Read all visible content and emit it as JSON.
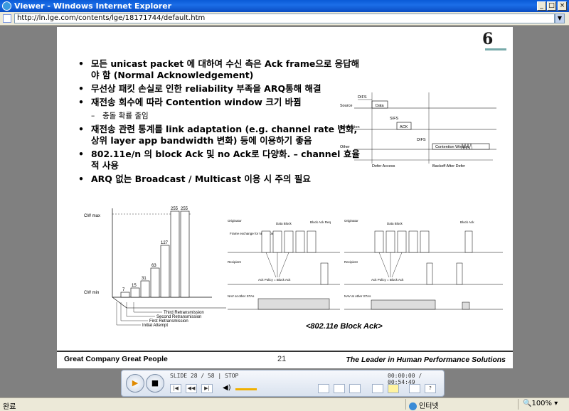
{
  "window": {
    "title": "Viewer - Windows Internet Explorer",
    "minimize": "_",
    "maximize": "□",
    "close": "×"
  },
  "address": {
    "url": "http://ln.lge.com/contents/lge/18171744/default.htm"
  },
  "slide": {
    "logo": "6",
    "bullets": [
      "모든 unicast packet 에 대하여 수신 측은 Ack frame으로 응답해야 함 (Normal Acknowledgement)",
      "무선상 패킷 손실로 인한 reliability 부족을 ARQ통해 해결",
      "재전송 회수에 따라 Contention window 크기 바뀜",
      "재전송 관련 통계를 link adaptation (e.g. channel rate 변화, 상위 layer app bandwidth 변화) 등에 이용하기 좋음",
      "802.11e/n 의 block Ack 및 no Ack로 다양화. – channel 효율적 사용",
      "ARQ 없는 Broadcast / Multicast 이용 시 주의 필요"
    ],
    "sub_bullet": "충돌 확률 줄임",
    "timing": {
      "difs1": "DIFS",
      "sifs": "SIFS",
      "difs2": "DIFS",
      "data": "Data",
      "ack": "ACK",
      "cw": "Contention Window",
      "source": "Source",
      "destination": "Destination",
      "other": "Other",
      "defer_access": "Defer Access",
      "backoff": "Backoff After Defer"
    },
    "cw_chart": {
      "cw_max": "CW max",
      "cw_min": "CW min",
      "values": [
        "7",
        "15",
        "31",
        "63",
        "127",
        "255",
        "255"
      ],
      "third": "Third Retransmission",
      "second": "Second Retransmission",
      "first": "First Retransmission",
      "initial": "Initial Attempt"
    },
    "blockack": {
      "originator": "Originator",
      "recipient": "Recipient",
      "nav": "NAV at other STAs",
      "data_block": "Data Block",
      "block_ack": "Block Ack",
      "block_ack_req": "Block Ack Req",
      "ack_policy": "Ack Policy = Block Ack",
      "protection": "Frame exchange for NAV Protection",
      "caption": "<802.11e Block Ack>"
    },
    "footer_left": "Great Company   Great People",
    "footer_num": "21",
    "footer_right": "The Leader in Human Performance Solutions"
  },
  "player": {
    "play": "▶",
    "stop": "■",
    "slide_info": "SLIDE 28 / 58     | STOP",
    "time": "00:00:00 / 00:54:49",
    "prev": "|◀",
    "rew": "◀◀",
    "next": "▶|"
  },
  "status": {
    "text": "완료",
    "zone": "인터넷",
    "zoom": "100%"
  }
}
